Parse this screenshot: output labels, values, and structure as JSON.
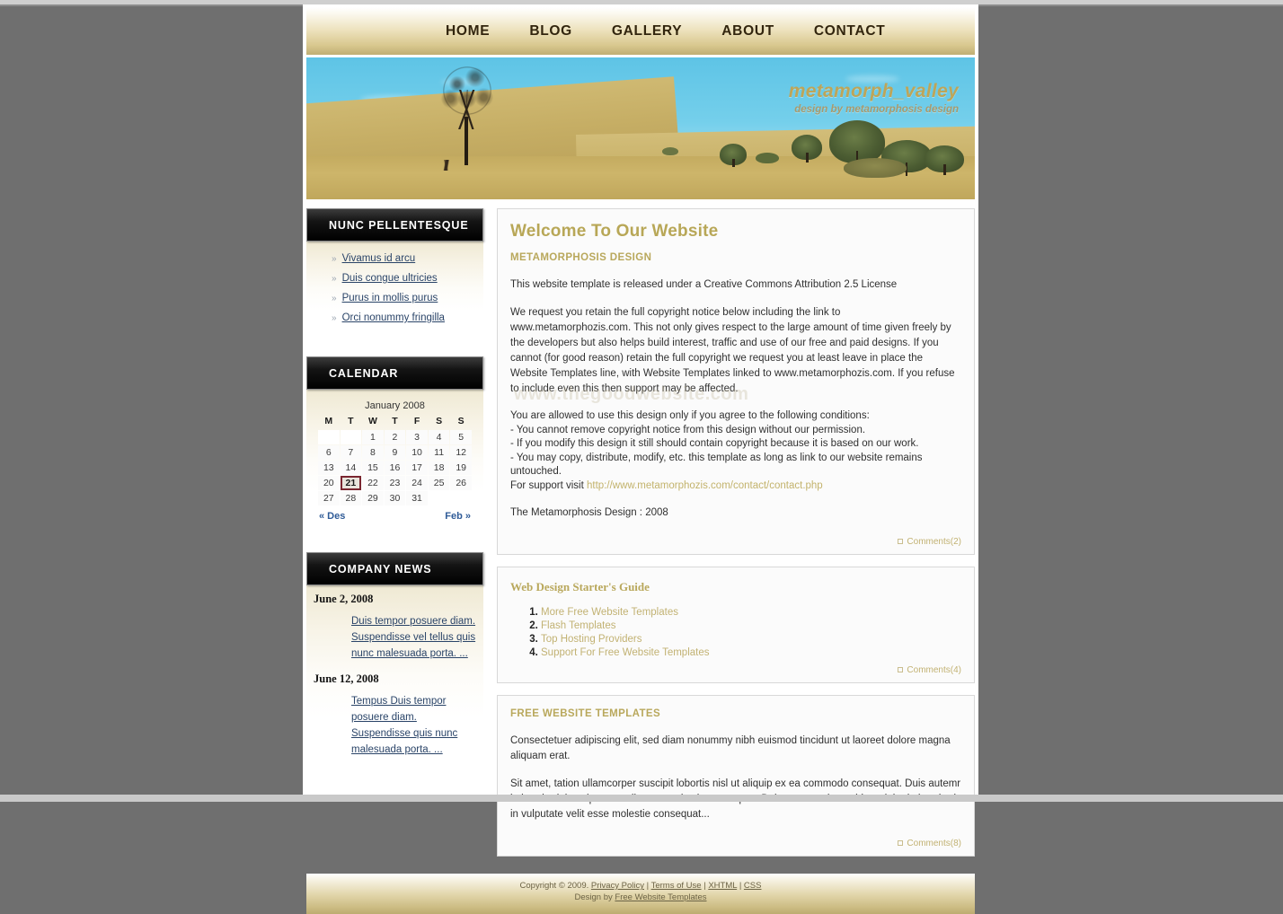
{
  "nav": {
    "items": [
      {
        "label": "HOME"
      },
      {
        "label": "BLOG"
      },
      {
        "label": "GALLERY"
      },
      {
        "label": "ABOUT"
      },
      {
        "label": "CONTACT"
      }
    ]
  },
  "banner": {
    "title": "metamorph_valley",
    "subtitle": "design by metamorphosis design"
  },
  "sidebar": {
    "links_block": {
      "heading": "NUNC PELLENTESQUE",
      "bullet": "»",
      "items": [
        {
          "label": "Vivamus id arcu"
        },
        {
          "label": "Duis congue ultricies"
        },
        {
          "label": "Purus in mollis purus"
        },
        {
          "label": "Orci nonummy fringilla"
        }
      ]
    },
    "calendar_block": {
      "heading": "CALENDAR",
      "caption": "January 2008",
      "weekdays": [
        "M",
        "T",
        "W",
        "T",
        "F",
        "S",
        "S"
      ],
      "weeks": [
        [
          "",
          "",
          "1",
          "2",
          "3",
          "4",
          "5"
        ],
        [
          "6",
          "7",
          "8",
          "9",
          "10",
          "11",
          "12"
        ],
        [
          "13",
          "14",
          "15",
          "16",
          "17",
          "18",
          "19"
        ],
        [
          "20",
          "21",
          "22",
          "23",
          "24",
          "25",
          "26"
        ],
        [
          "27",
          "28",
          "29",
          "30",
          "31",
          "",
          ""
        ]
      ],
      "today": "21",
      "prev_label": "« Des",
      "next_label": "Feb »",
      "highlight_color": "#7a2630"
    },
    "news_block": {
      "heading": "COMPANY NEWS",
      "entries": [
        {
          "date": "June 2, 2008",
          "text": "Duis tempor posuere diam. Suspendisse vel tellus quis nunc malesuada porta. ..."
        },
        {
          "date": "June 12, 2008",
          "text": "Tempus Duis tempor posuere diam. Suspendisse quis nunc malesuada porta. ..."
        }
      ]
    }
  },
  "main": {
    "welcome_panel": {
      "title": "Welcome To Our Website",
      "subtitle": "METAMORPHOSIS DESIGN",
      "para1": "This website template is released under a Creative Commons Attribution 2.5 License",
      "para2": "We request you retain the full copyright notice below including the link to www.metamorphozis.com. This not only gives respect to the large amount of time given freely by the developers but also helps build interest, traffic and use of our free and paid designs. If you cannot (for good reason) retain the full copyright we request you at least leave in place the Website Templates line, with Website Templates linked to www.metamorphozis.com. If you refuse to include even this then support may be affected.",
      "cond_intro": "You are allowed to use this design only if you agree to the following conditions:",
      "cond1": "- You cannot remove copyright notice from this design without our permission.",
      "cond2": "- If you modify this design it still should contain copyright because it is based on our work.",
      "cond3": "- You may copy, distribute, modify, etc. this template as long as link to our website remains untouched.",
      "support_prefix": "For support visit ",
      "support_link": "http://www.metamorphozis.com/contact/contact.php",
      "signature": "The Metamorphosis Design : 2008",
      "comments": "Comments(2)",
      "watermark": "www.thegoodwebsite.com"
    },
    "guide_panel": {
      "title": "Web Design Starter's Guide",
      "items": [
        {
          "label": "More Free Website Templates"
        },
        {
          "label": "Flash Templates"
        },
        {
          "label": "Top Hosting Providers"
        },
        {
          "label": "Support For Free Website Templates"
        }
      ],
      "comments": "Comments(4)"
    },
    "templates_panel": {
      "title": "FREE WEBSITE TEMPLATES",
      "para1": "Consectetuer adipiscing elit, sed diam nonummy nibh euismod tincidunt ut laoreet dolore magna aliquam erat.",
      "para2": "Sit amet, tation ullamcorper suscipit lobortis nisl ut aliquip ex ea commodo consequat. Duis autemr in hendrerit in vulputate velit esse molestie consequat. Duis autem vel eum iriure dolor in hendrerit in vulputate velit esse molestie consequat...",
      "comments": "Comments(8)"
    }
  },
  "footer": {
    "copyright": "Copyright © 2009.",
    "privacy": "Privacy Policy",
    "sep1": "|",
    "terms": "Terms of Use",
    "sep2": "|",
    "xhtml": "XHTML",
    "sep3": "|",
    "css": "CSS",
    "design_prefix": "Design by",
    "design_link": "Free Website Templates"
  }
}
